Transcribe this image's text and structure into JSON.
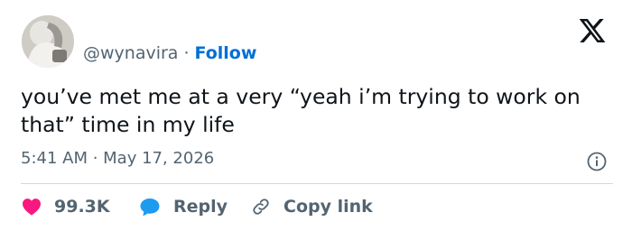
{
  "user": {
    "handle": "@wynavira",
    "separator": "·",
    "follow_label": "Follow",
    "avatar_icon": "profile-photo"
  },
  "tweet": {
    "text": "you’ve met me at a very “yeah i’m trying to work on that” time in my life",
    "timestamp": "5:41 AM · May 17, 2026"
  },
  "actions": {
    "likes": "99.3K",
    "reply_label": "Reply",
    "copy_link_label": "Copy link"
  },
  "icons": {
    "brand": "x-logo-icon",
    "info": "info-icon",
    "like": "heart-icon",
    "reply": "reply-bubble-icon",
    "copy": "link-icon"
  },
  "colors": {
    "follow": "#006fd6",
    "heart": "#f91880",
    "reply": "#1d9bf0",
    "muted": "#536471"
  }
}
